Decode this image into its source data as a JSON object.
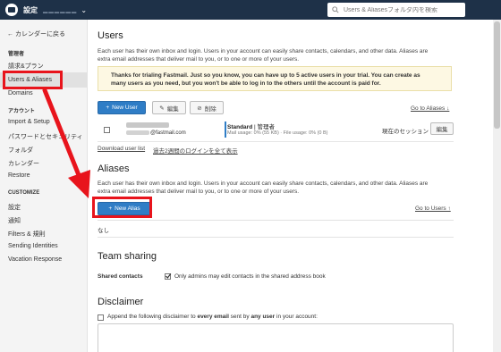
{
  "topbar": {
    "title": "設定",
    "account": "▁▁▁▁▁▁",
    "caret": "⌄",
    "search_placeholder": "Users & Aliasesフォルダ内を検索"
  },
  "sidebar": {
    "back_label": "← カレンダーに戻る",
    "sections": [
      {
        "title": "管理者",
        "items": [
          "請求&プラン",
          "Users & Aliases",
          "Domains"
        ]
      },
      {
        "title": "アカウント",
        "items": [
          "Import & Setup",
          "パスワードとセキュリティ",
          "フォルダ",
          "カレンダー",
          "Restore"
        ]
      },
      {
        "title": "CUSTOMIZE",
        "items": [
          "設定",
          "通知",
          "Filters & 規則",
          "Sending Identities",
          "Vacation Response"
        ]
      }
    ]
  },
  "users": {
    "heading": "Users",
    "description_1": "Each user has their own inbox and login. Users in your account can easily share contacts, calendars, and other data. Aliases are",
    "description_2": "extra email addresses that deliver mail to you, or to one or more of your users.",
    "notice_1": "Thanks for trialing Fastmail. Just so you know, you can have up to 5 active users in your trial. You can create as",
    "notice_2": "many users as you need, but you won't be able to log in to the others until the account is paid for.",
    "new_user_label": "New User",
    "edit_label": "編集",
    "delete_label": "削除",
    "go_to_aliases": "Go to Aliases ↓",
    "row": {
      "email_suffix": "@fastmail.com",
      "plan": "Standard",
      "role": "| 管理者",
      "usage": "Mail usage: 0% (55 KB) · File usage: 0% (0 B)",
      "session": "現在のセッション",
      "edit_label": "編集"
    },
    "download_link": "Download user list",
    "logout_link": "過去2週間のログインを全て表示"
  },
  "aliases": {
    "heading": "Aliases",
    "description_1": "Each user has their own inbox and login. Users in your account can easily share contacts, calendars, and other data. Aliases are",
    "description_2": "extra email addresses that deliver mail to you, or to one or more of your users.",
    "new_alias_label": "New Alias",
    "go_to_users": "Go to Users ↑",
    "empty_text": "なし"
  },
  "team_sharing": {
    "heading": "Team sharing",
    "label": "Shared contacts",
    "option_text": "Only admins may edit contacts in the shared address book"
  },
  "disclaimer": {
    "heading": "Disclaimer",
    "text_a": "Append the following disclaimer to ",
    "text_b": "every email",
    "text_c": " sent by ",
    "text_d": "any user",
    "text_e": " in your account:"
  },
  "colors": {
    "topbar": "#1e3148",
    "primary": "#2f7dc6",
    "highlight": "#e8141c",
    "notice_bg": "#fdf8e3"
  }
}
